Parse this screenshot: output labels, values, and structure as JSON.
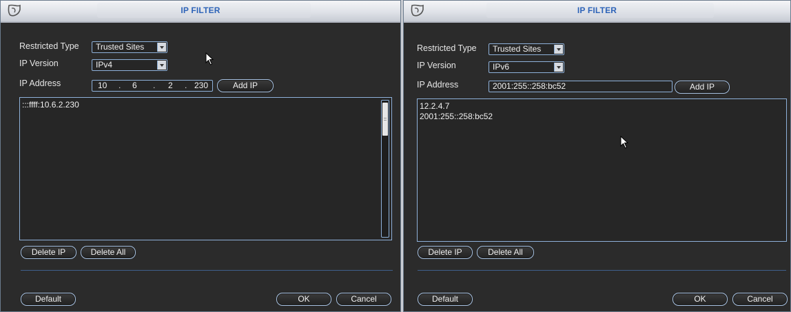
{
  "left_dialog": {
    "title": "IP FILTER",
    "restricted_type_label": "Restricted Type",
    "restricted_type_value": "Trusted Sites",
    "ip_version_label": "IP Version",
    "ip_version_value": "IPv4",
    "ip_address_label": "IP Address",
    "ip_octets": [
      "10",
      "6",
      "2",
      "230"
    ],
    "ip_separator": ".",
    "add_ip_label": "Add IP",
    "list_items": [
      ":::ffff:10.6.2.230"
    ],
    "delete_ip_label": "Delete IP",
    "delete_all_label": "Delete All",
    "default_label": "Default",
    "ok_label": "OK",
    "cancel_label": "Cancel"
  },
  "right_dialog": {
    "title": "IP FILTER",
    "restricted_type_label": "Restricted Type",
    "restricted_type_value": "Trusted Sites",
    "ip_version_label": "IP Version",
    "ip_version_value": "IPv6",
    "ip_address_label": "IP Address",
    "ip_address_value": "2001:255::258:bc52",
    "add_ip_label": "Add IP",
    "list_items": [
      "12.2.4.7",
      "2001:255::258:bc52"
    ],
    "delete_ip_label": "Delete IP",
    "delete_all_label": "Delete All",
    "default_label": "Default",
    "ok_label": "OK",
    "cancel_label": "Cancel"
  },
  "icons": {
    "logo": "app-logo-icon",
    "dropdown": "chevron-down-icon",
    "cursor": "mouse-pointer-icon"
  },
  "colors": {
    "dialog_bg": "#2b2b2b",
    "title_text": "#2d63b8",
    "field_border": "#8fb2db",
    "text": "#e6e6e6"
  }
}
